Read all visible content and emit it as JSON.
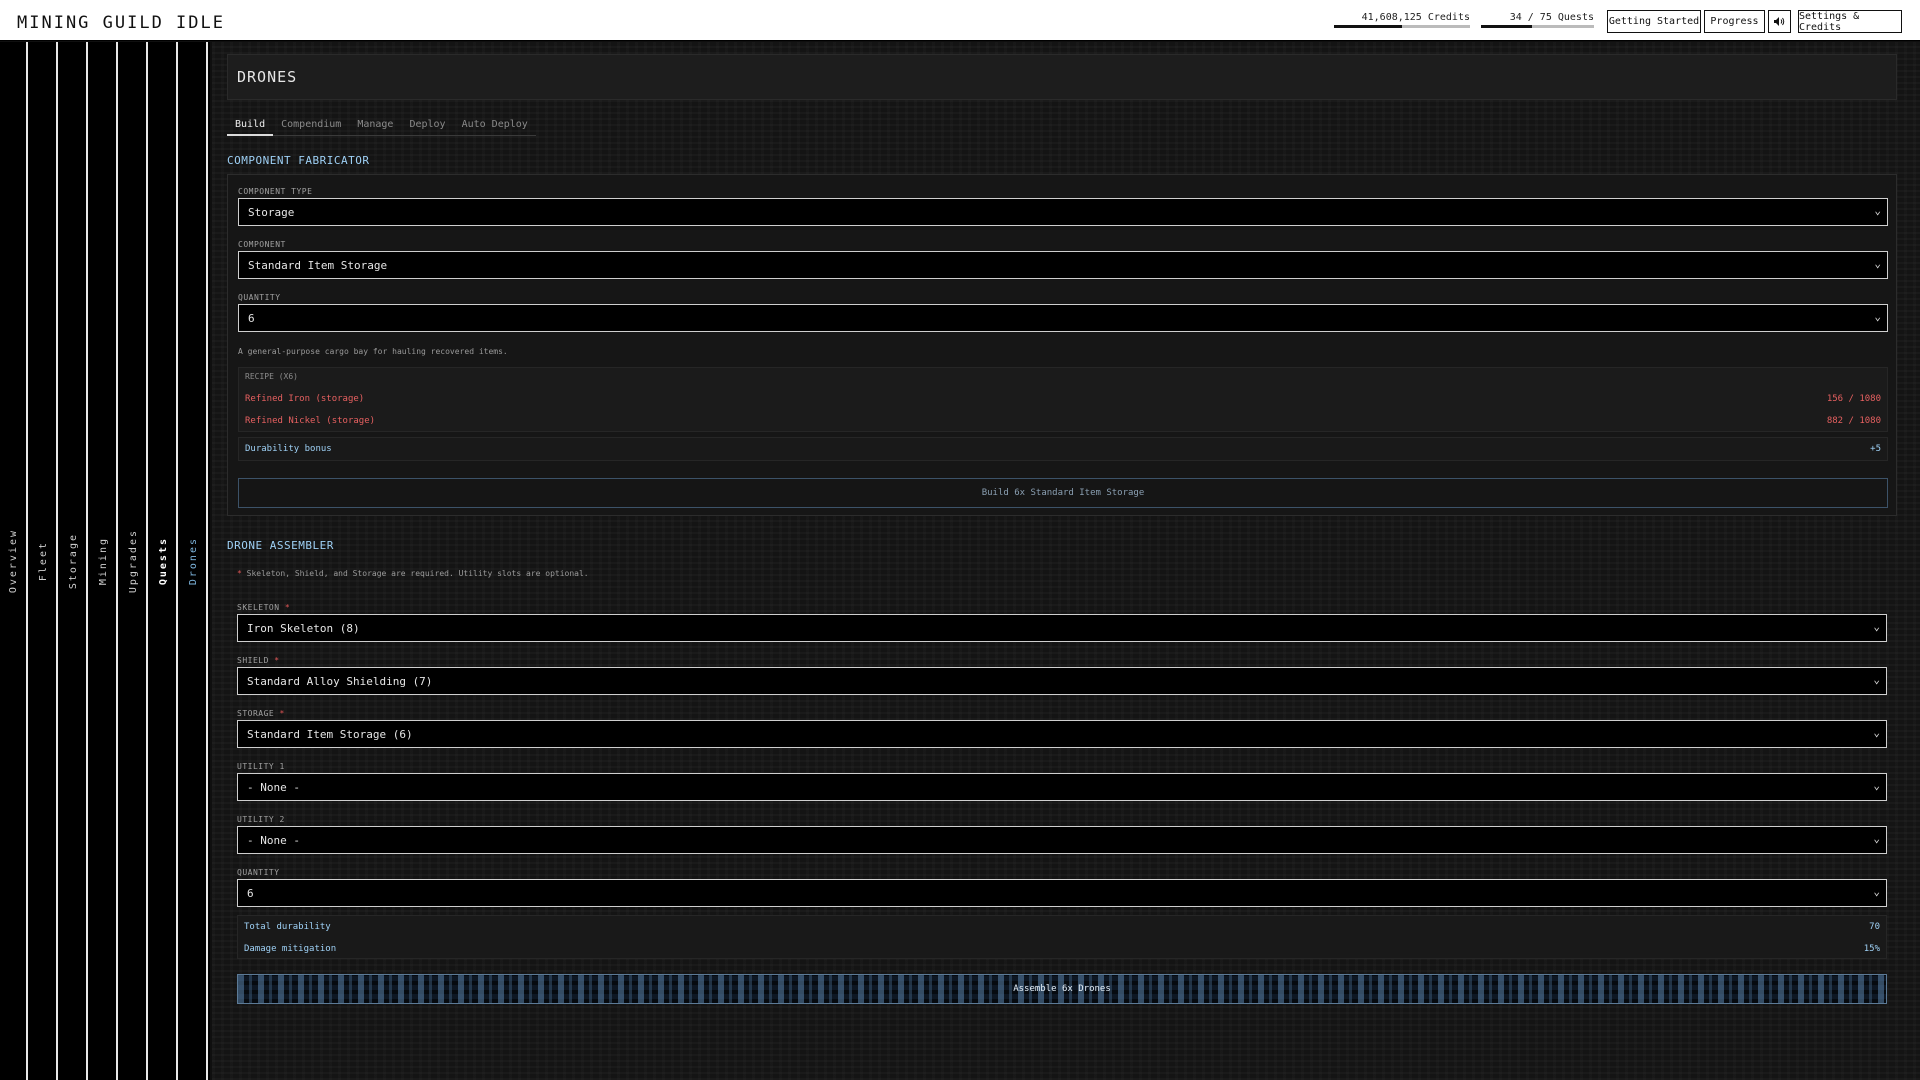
{
  "app": {
    "title": "MINING GUILD IDLE"
  },
  "header": {
    "credits": {
      "label": "41,608,125 Credits",
      "progress": 0.5
    },
    "quests": {
      "label": "34 / 75 Quests",
      "progress": 0.45
    },
    "buttons": {
      "getting_started": "Getting Started",
      "progress": "Progress",
      "sound_icon": "speaker-icon",
      "settings": "Settings & Credits"
    }
  },
  "sidebar": {
    "items": [
      {
        "label": "Overview"
      },
      {
        "label": "Fleet"
      },
      {
        "label": "Storage"
      },
      {
        "label": "Mining"
      },
      {
        "label": "Upgrades"
      },
      {
        "label": "Quests"
      },
      {
        "label": "Drones"
      }
    ],
    "active": "Drones"
  },
  "page": {
    "title": "DRONES",
    "tabs": [
      "Build",
      "Compendium",
      "Manage",
      "Deploy",
      "Auto Deploy"
    ],
    "active_tab": "Build"
  },
  "fabricator": {
    "title": "COMPONENT FABRICATOR",
    "component_type_label": "COMPONENT TYPE",
    "component_type_value": "Storage",
    "component_label": "COMPONENT",
    "component_value": "Standard Item Storage",
    "quantity_label": "QUANTITY",
    "quantity_value": "6",
    "description": "A general-purpose cargo bay for hauling recovered items.",
    "recipe_header": "RECIPE (X6)",
    "recipe": [
      {
        "name": "Refined Iron (storage)",
        "amount": "156 / 1080"
      },
      {
        "name": "Refined Nickel (storage)",
        "amount": "882 / 1080"
      }
    ],
    "bonus_label": "Durability bonus",
    "bonus_value": "+5",
    "build_button": "Build 6x Standard Item Storage",
    "status_color": "#e66060"
  },
  "assembler": {
    "title": "DRONE ASSEMBLER",
    "note_marker": "*",
    "note": "Skeleton, Shield, and Storage are required. Utility slots are optional.",
    "skeleton_label": "SKELETON",
    "skeleton_value": "Iron Skeleton (8)",
    "shield_label": "SHIELD",
    "shield_value": "Standard Alloy Shielding (7)",
    "storage_label": "STORAGE",
    "storage_value": "Standard Item Storage (6)",
    "utility1_label": "UTILITY 1",
    "utility1_value": "- None -",
    "utility2_label": "UTILITY 2",
    "utility2_value": "- None -",
    "quantity_label": "QUANTITY",
    "quantity_value": "6",
    "required_marker": "*",
    "stats": [
      {
        "label": "Total durability",
        "value": "70"
      },
      {
        "label": "Damage mitigation",
        "value": "15%"
      }
    ],
    "assemble_button": "Assemble 6x Drones",
    "accent_color": "#9ed0f5"
  }
}
